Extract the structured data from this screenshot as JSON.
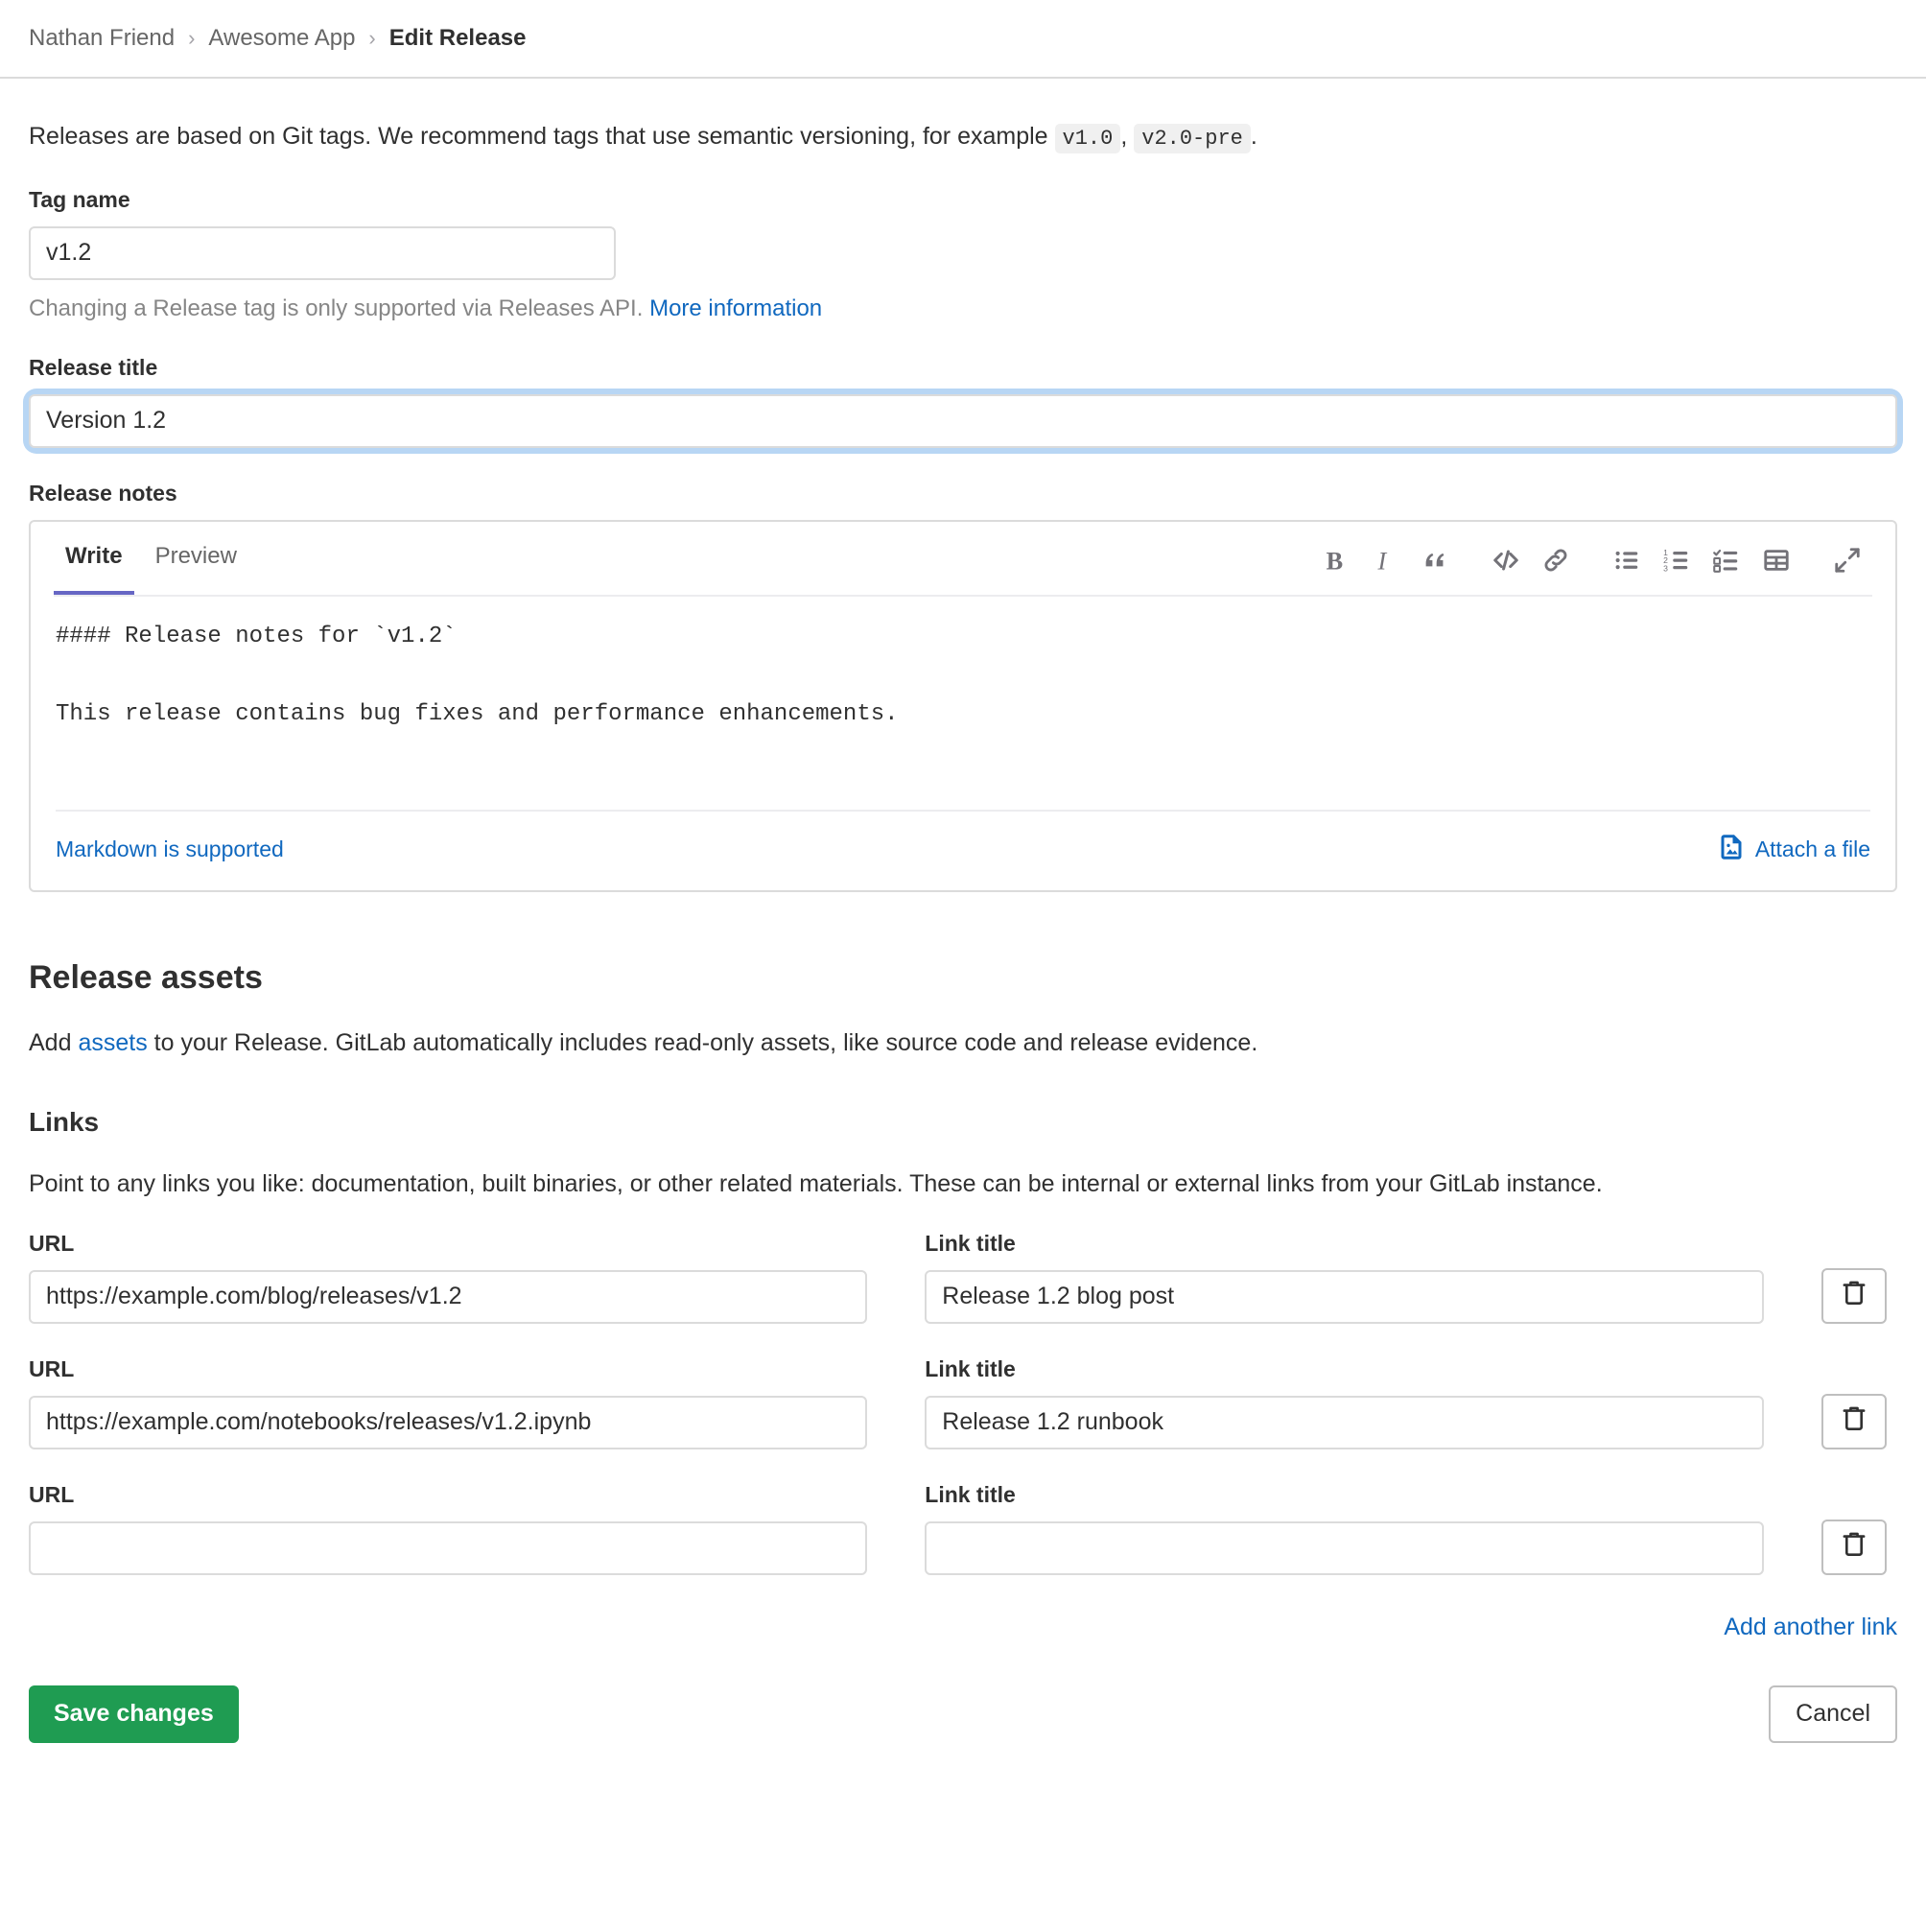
{
  "breadcrumb": {
    "separator": "›",
    "items": [
      {
        "label": "Nathan Friend",
        "current": false
      },
      {
        "label": "Awesome App",
        "current": false
      },
      {
        "label": "Edit Release",
        "current": true
      }
    ]
  },
  "intro": {
    "before": "Releases are based on Git tags. We recommend tags that use semantic versioning, for example ",
    "code1": "v1.0",
    "middle": ",",
    "code2": "v2.0-pre",
    "after": "."
  },
  "tag": {
    "label": "Tag name",
    "value": "v1.2",
    "placeholder": "",
    "help_text": "Changing a Release tag is only supported via Releases API.",
    "help_link": "More information"
  },
  "release_title": {
    "label": "Release title",
    "value": "Version 1.2",
    "placeholder": "Release title"
  },
  "release_notes": {
    "label": "Release notes",
    "tabs": [
      {
        "label": "Write",
        "active": true
      },
      {
        "label": "Preview",
        "active": false
      }
    ],
    "toolbar": [
      {
        "name": "bold-icon",
        "title": "Add bold text"
      },
      {
        "name": "italic-icon",
        "title": "Add italic text"
      },
      {
        "name": "quote-icon",
        "title": "Insert a quote"
      },
      {
        "name": "code-icon",
        "title": "Insert code"
      },
      {
        "name": "link-icon",
        "title": "Add a link"
      },
      {
        "name": "bullet-list-icon",
        "title": "Add a bullet list"
      },
      {
        "name": "numbered-list-icon",
        "title": "Add a numbered list"
      },
      {
        "name": "task-list-icon",
        "title": "Add a checklist"
      },
      {
        "name": "table-icon",
        "title": "Add a table"
      },
      {
        "name": "fullscreen-icon",
        "title": "Go full screen"
      }
    ],
    "content": "#### Release notes for `v1.2`\n\nThis release contains bug fixes and performance enhancements.",
    "markdown_hint": "Markdown is supported",
    "attach_label": "Attach a file"
  },
  "assets": {
    "heading": "Release assets",
    "description_before": "Add ",
    "description_link": "assets",
    "description_after": " to your Release. GitLab automatically includes read-only assets, like source code and release evidence."
  },
  "links_section": {
    "heading": "Links",
    "description": "Point to any links you like: documentation, built binaries, or other related materials. These can be internal or external links from your GitLab instance.",
    "url_label": "URL",
    "title_label": "Link title",
    "url_placeholder": "",
    "title_placeholder": "",
    "delete_icon": "trash-icon",
    "add_another": "Add another link",
    "rows": [
      {
        "url": "https://example.com/blog/releases/v1.2",
        "title": "Release 1.2 blog post"
      },
      {
        "url": "https://example.com/notebooks/releases/v1.2.ipynb",
        "title": "Release 1.2 runbook"
      },
      {
        "url": "",
        "title": ""
      }
    ]
  },
  "actions": {
    "save_label": "Save changes",
    "cancel_label": "Cancel"
  },
  "colors": {
    "link_blue": "#1068bf",
    "save_green": "#1f9c52",
    "tab_accent": "#6666c4",
    "focus_ring": "#b8d6f4",
    "muted_text": "#868686",
    "border": "#dbdbdb"
  }
}
